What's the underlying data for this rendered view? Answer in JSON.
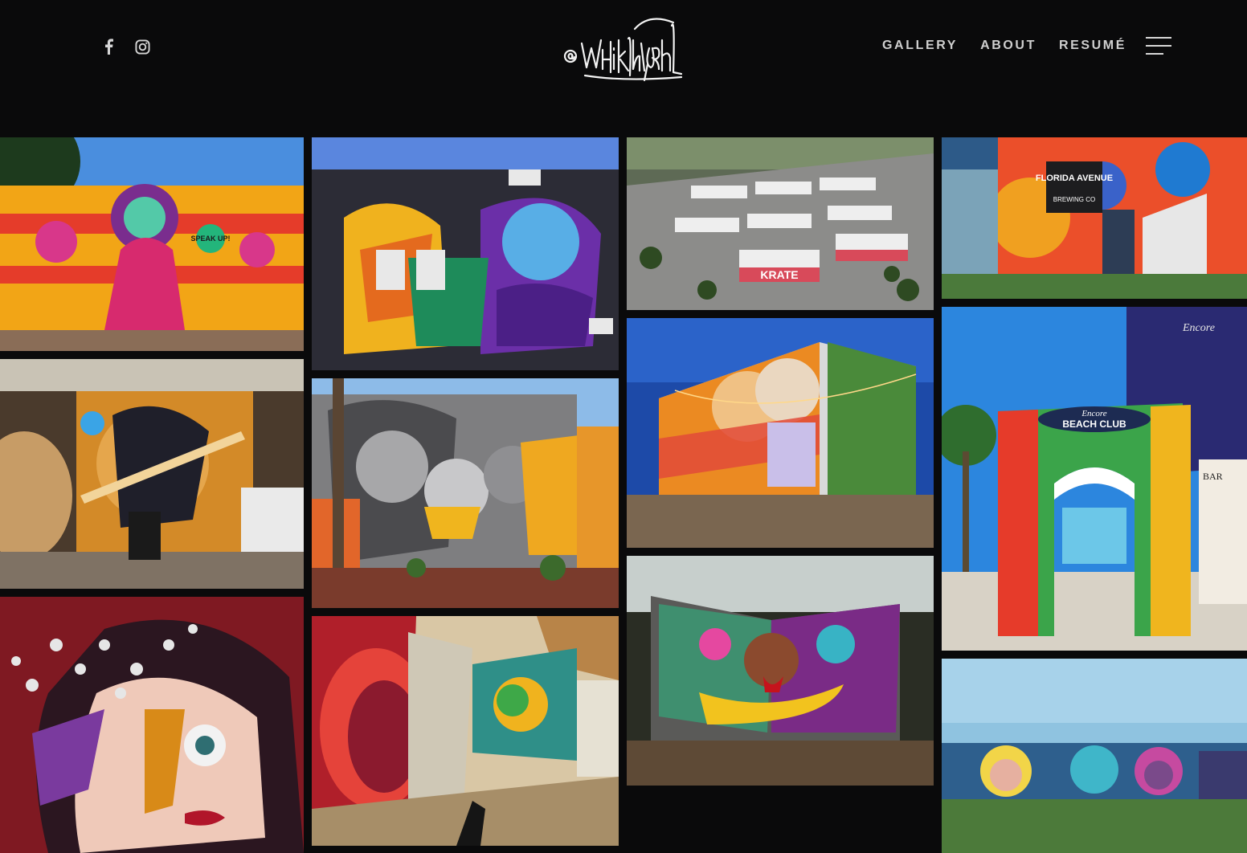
{
  "header": {
    "logo_text": "@whitneyhoborn",
    "social": [
      {
        "name": "facebook-icon"
      },
      {
        "name": "instagram-icon"
      }
    ],
    "nav": [
      {
        "label": "GALLERY"
      },
      {
        "label": "ABOUT"
      },
      {
        "label": "RESUMÉ"
      }
    ]
  },
  "gallery": {
    "mural_texts": {
      "speak_up": "SPEAK UP!",
      "krate": "KRATE",
      "florida_avenue": "FLORIDA AVENUE",
      "brewing": "BREWING CO",
      "encore": "Encore",
      "beach_club": "BEACH CLUB",
      "bar": "BAR"
    }
  },
  "colors": {
    "background": "#0a0a0b",
    "nav_text": "#cfcfcf"
  }
}
